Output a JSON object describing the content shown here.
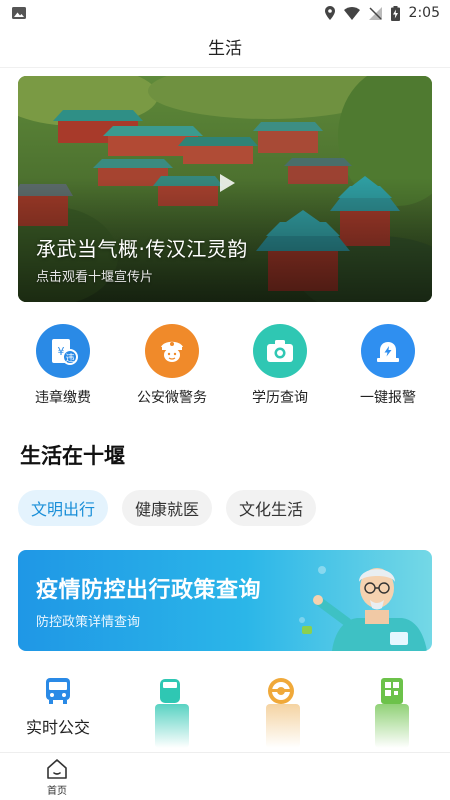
{
  "status_bar": {
    "time": "2:05",
    "icons": [
      "image-icon",
      "location-icon",
      "wifi-icon",
      "no-sim-icon",
      "battery-charging-icon"
    ]
  },
  "header": {
    "title": "生活"
  },
  "banner": {
    "title": "承武当气概·传汉江灵韵",
    "subtitle": "点击观看十堰宣传片",
    "icon": "play-icon"
  },
  "services": [
    {
      "label": "违章缴费",
      "icon": "traffic-fine-icon",
      "color": "#2a8ae6"
    },
    {
      "label": "公安微警务",
      "icon": "police-officer-icon",
      "color": "#f08a2a"
    },
    {
      "label": "学历查询",
      "icon": "camera-icon",
      "color": "#2fc7b3"
    },
    {
      "label": "一键报警",
      "icon": "alarm-light-icon",
      "color": "#2f8ff0"
    }
  ],
  "section": {
    "title": "生活在十堰",
    "tabs": [
      {
        "label": "文明出行",
        "active": true
      },
      {
        "label": "健康就医",
        "active": false
      },
      {
        "label": "文化生活",
        "active": false
      }
    ]
  },
  "policy_card": {
    "title": "疫情防控出行政策查询",
    "subtitle": "防控政策详情查询"
  },
  "features": [
    {
      "label": "实时公交",
      "icon": "bus-icon",
      "color": "#2a8ae6"
    },
    {
      "label": "",
      "icon": "car-icon",
      "color": "#2fc7b3"
    },
    {
      "label": "",
      "icon": "steering-wheel-icon",
      "color": "#f0a93a"
    },
    {
      "label": "",
      "icon": "qr-code-icon",
      "color": "#6cc24a"
    }
  ],
  "bottom_nav": {
    "items": [
      {
        "label": "首页",
        "icon": "home-icon"
      }
    ]
  }
}
